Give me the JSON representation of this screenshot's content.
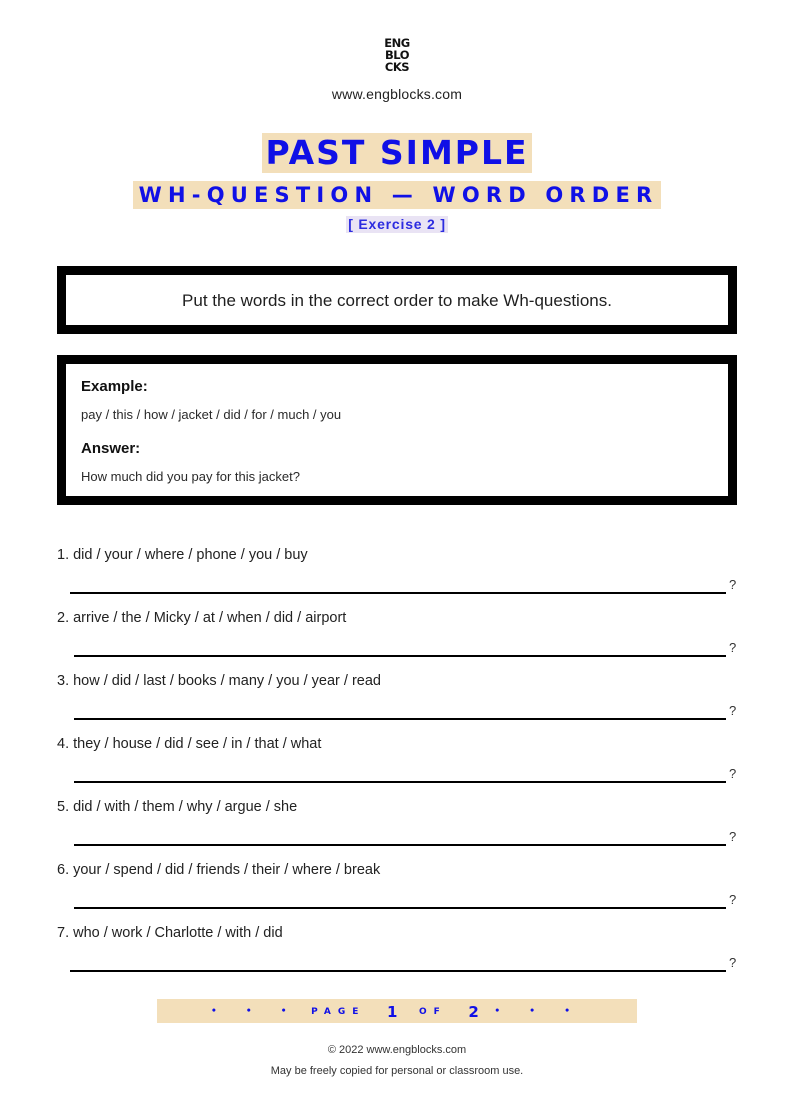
{
  "header": {
    "logo_lines": [
      "ENG",
      "BLO",
      "CKS"
    ],
    "site_url": "www.engblocks.com"
  },
  "titles": {
    "main": "PAST SIMPLE",
    "subtitle": "WH-QUESTION — WORD ORDER",
    "exercise": "[ Exercise 2 ]"
  },
  "instruction": "Put the words in the correct order to make Wh-questions.",
  "example": {
    "label": "Example:",
    "words": "pay / this / how / jacket / did / for / much / you",
    "answer_label": "Answer:",
    "answer": "How much did you pay for this jacket?"
  },
  "questions": [
    {
      "text": "1. did / your / where / phone / you / buy",
      "end_mark": "?"
    },
    {
      "text": "2. arrive / the / Micky / at / when / did / airport",
      "end_mark": "?"
    },
    {
      "text": "3. how / did / last / books / many / you / year / read",
      "end_mark": "?"
    },
    {
      "text": "4. they / house / did / see / in / that / what",
      "end_mark": "?"
    },
    {
      "text": "5. did / with / them / why / argue / she",
      "end_mark": "?"
    },
    {
      "text": "6. your / spend / did / friends / their / where / break",
      "end_mark": "?"
    },
    {
      "text": "7. who / work / Charlotte / with / did",
      "end_mark": "?"
    }
  ],
  "pagination": {
    "dots": "• • •",
    "page_word": "PAGE",
    "current": "1",
    "of_word": "OF",
    "total": "2"
  },
  "footer": {
    "copyright": "© 2022 www.engblocks.com",
    "license": "May be freely copied for personal or classroom use."
  },
  "colors": {
    "accent_blue": "#1010e6",
    "highlight_beige": "#f3dfba",
    "border_black": "#000000"
  }
}
